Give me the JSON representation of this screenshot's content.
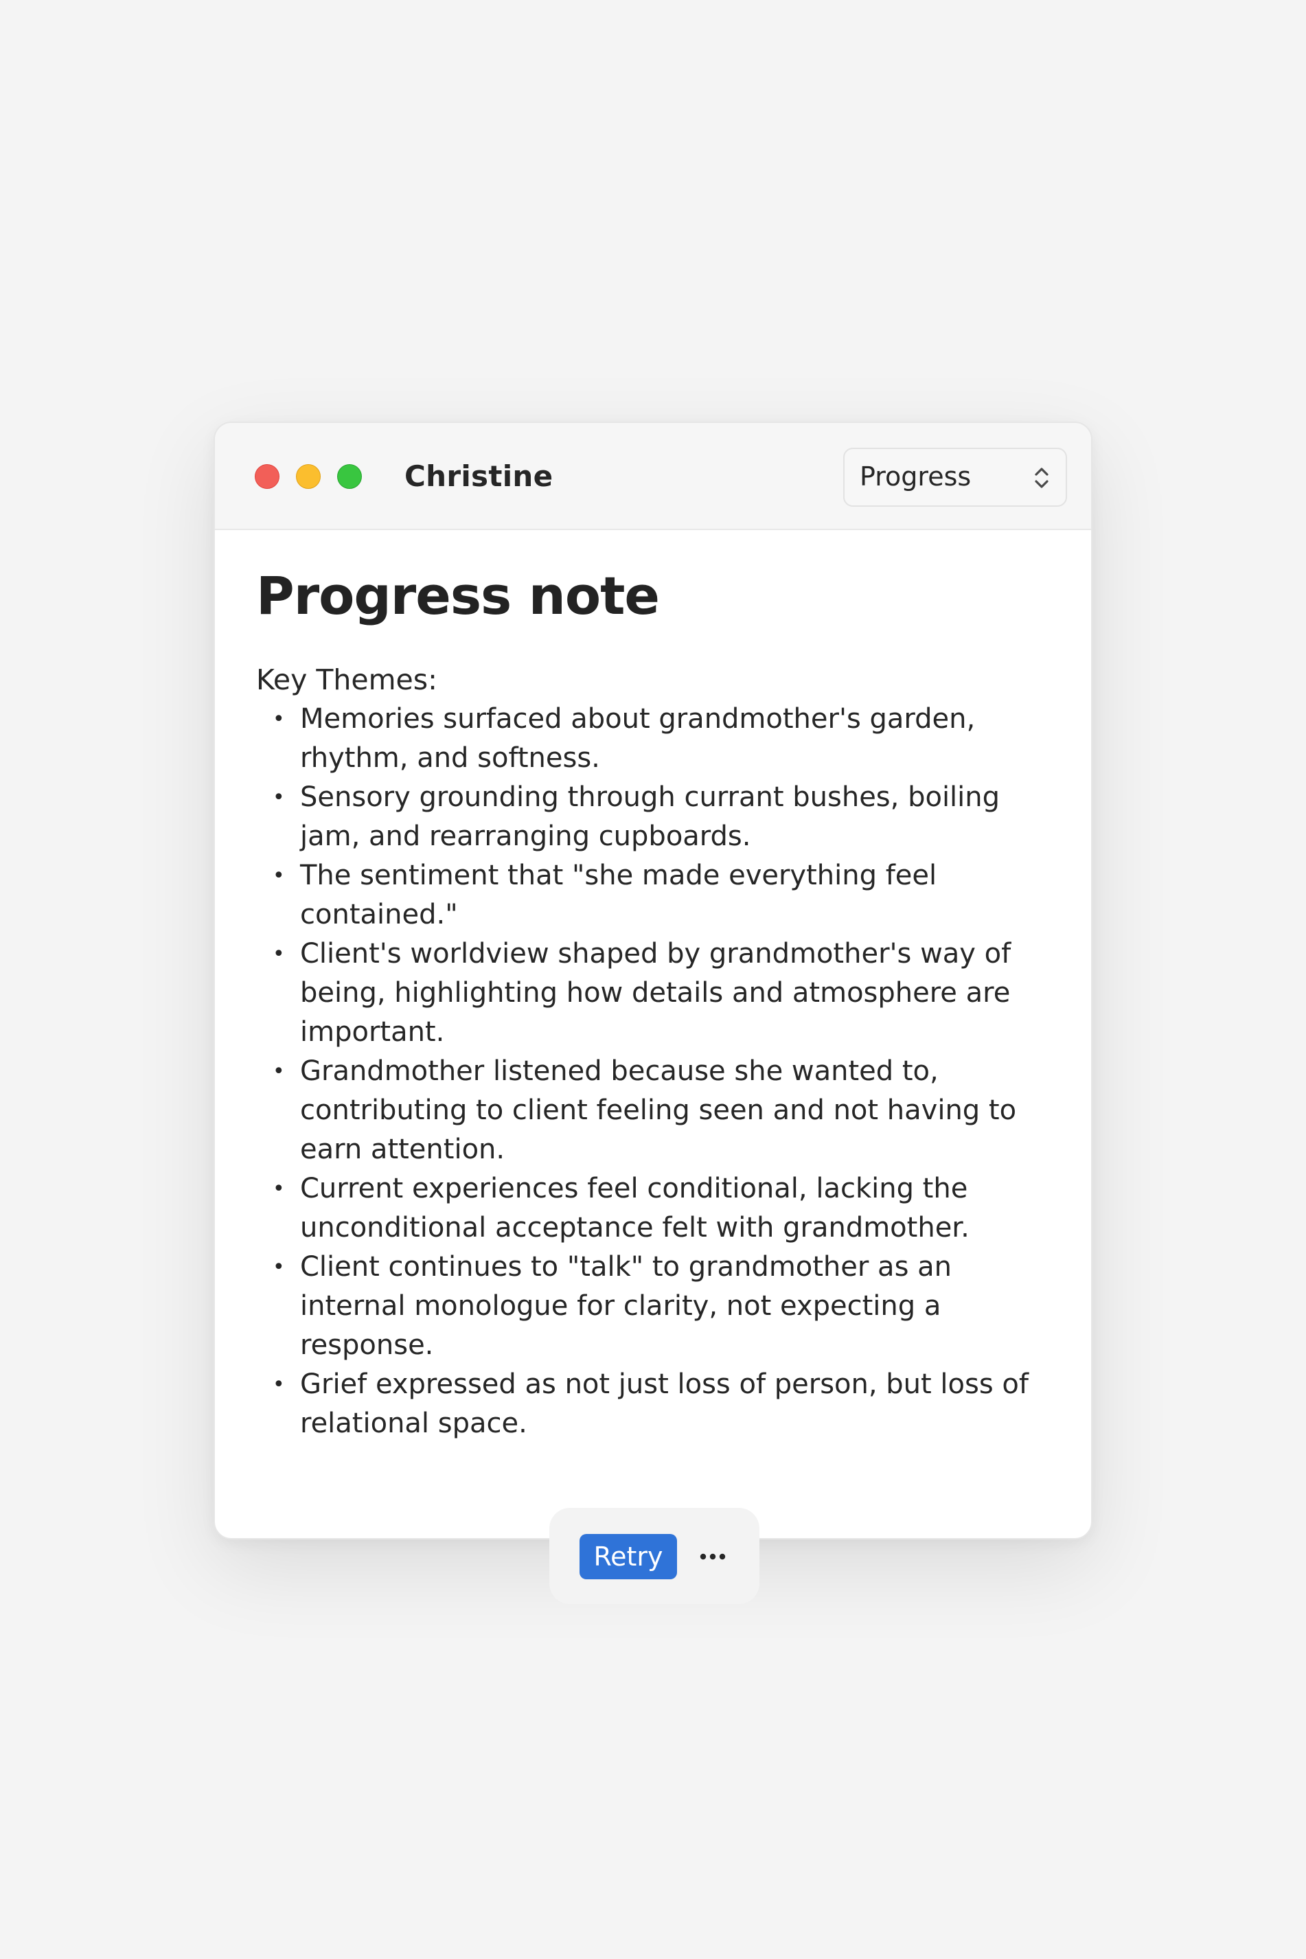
{
  "window": {
    "title": "Christine",
    "controls": [
      "close",
      "minimize",
      "zoom"
    ]
  },
  "note_type_select": {
    "value": "Progress"
  },
  "note": {
    "title": "Progress note",
    "section_label": "Key Themes:",
    "themes": [
      "Memories surfaced about grandmother's garden, rhythm, and softness.",
      "Sensory grounding through currant bushes, boiling jam, and rearranging cupboards.",
      "The sentiment that \"she made everything feel contained.\"",
      "Client's worldview shaped by grandmother's way of being, highlighting how details and atmosphere are important.",
      "Grandmother listened because she wanted to, contributing to client feeling seen and not having to earn attention.",
      "Current experiences feel conditional, lacking the unconditional acceptance felt with grandmother.",
      "Client continues to \"talk\" to grandmother as an internal monologue for clarity, not expecting a response.",
      "Grief expressed as not just loss of person, but loss of relational space."
    ]
  },
  "actions": {
    "retry_label": "Retry",
    "more_icon": "ellipsis-icon"
  },
  "colors": {
    "close": "#f25f58",
    "minimize": "#fbbe2e",
    "zoom": "#39c640",
    "accent": "#2f73d8",
    "background": "#f4f4f4"
  }
}
